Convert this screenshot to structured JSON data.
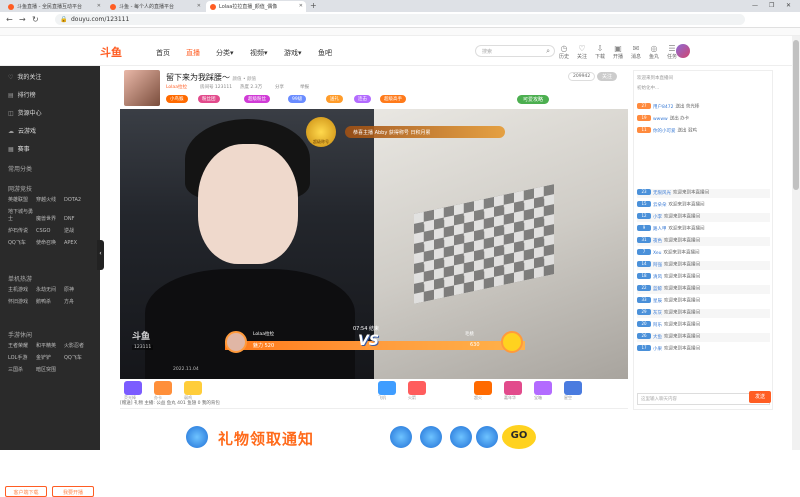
{
  "browser": {
    "tabs": [
      {
        "label": "斗鱼直播 - 全民直播互动平台",
        "icon_color": "#ff5d23"
      },
      {
        "label": "斗鱼 - 每个人的直播平台",
        "icon_color": "#ff5d23"
      },
      {
        "label": "Lolaa拉拉直播_颜值_偶像",
        "icon_color": "#ff5d23"
      }
    ],
    "new_tab": "+",
    "url": "douyu.com/123111",
    "window_controls": [
      "—",
      "❐",
      "✕"
    ]
  },
  "header": {
    "logo": "斗鱼",
    "nav": [
      {
        "label": "首页",
        "active": false
      },
      {
        "label": "直播",
        "active": true
      },
      {
        "label": "分类▾",
        "active": false
      },
      {
        "label": "视频▾",
        "active": false
      },
      {
        "label": "游戏▾",
        "active": false
      },
      {
        "label": "鱼吧",
        "active": false
      }
    ],
    "search_placeholder": "搜索",
    "icons": [
      {
        "icon": "history-icon",
        "glyph": "◷",
        "label": "历史"
      },
      {
        "label": "关注",
        "icon": "follow-icon",
        "glyph": "♡"
      },
      {
        "label": "下载",
        "icon": "download-icon",
        "glyph": "⇩"
      },
      {
        "label": "开播",
        "icon": "live-icon",
        "glyph": "▣"
      },
      {
        "label": "消息",
        "icon": "message-icon",
        "glyph": "✉"
      },
      {
        "label": "鱼丸",
        "icon": "fishball-icon",
        "glyph": "◎"
      },
      {
        "label": "任务",
        "icon": "task-icon",
        "glyph": "☰"
      }
    ]
  },
  "sidebar": {
    "items": [
      {
        "icon": "heart-icon",
        "glyph": "♡",
        "label": "我的关注"
      },
      {
        "icon": "rank-icon",
        "glyph": "▤",
        "label": "排行榜"
      },
      {
        "icon": "shop-icon",
        "glyph": "◫",
        "label": "货源中心"
      },
      {
        "icon": "cloud-icon",
        "glyph": "☁",
        "label": "云游戏"
      },
      {
        "icon": "more-icon",
        "glyph": "▦",
        "label": "赛事"
      }
    ],
    "sections": [
      {
        "title": "常用分类",
        "items": []
      },
      {
        "title": "网游竞技",
        "items": [
          "英雄联盟",
          "穿越火线",
          "DOTA2",
          "地下城与勇士",
          "魔兽世界",
          "DNF",
          "炉石传说",
          "CSGO",
          "逆战",
          "QQ飞车",
          "使命召唤",
          "APEX"
        ]
      },
      {
        "title": "单机热游",
        "items": [
          "主机游戏",
          "永劫无间",
          "原神",
          "怀旧游戏",
          "鹅鸭杀",
          "方舟"
        ]
      },
      {
        "title": "手游休闲",
        "items": [
          "王者荣耀",
          "和平精英",
          "火影忍者",
          "LOL手游",
          "金铲铲",
          "QQ飞车",
          "三国杀",
          "暗区突围"
        ]
      }
    ],
    "bottom_buttons": [
      "客户端下载",
      "我要开播"
    ]
  },
  "room": {
    "title": "留下来为我踩腰～",
    "breadcrumb": "颜值 • 颜值",
    "anchor": "Lolaa拉拉",
    "room_no": "房间号 123111",
    "hot": "热度 2.3万",
    "meta_extra": "分享",
    "report": "举报",
    "tags": [
      {
        "label": "小鸟猴",
        "color": "#ff6a00"
      },
      {
        "label": "粉丝团",
        "color": "#e24b8c"
      },
      {
        "label": "超级粉丝",
        "color": "#d03bd6"
      },
      {
        "label": "99级",
        "color": "#6a8cff"
      },
      {
        "label": "送礼",
        "color": "#ff9c2a"
      },
      {
        "label": "连击",
        "color": "#b36bff"
      },
      {
        "label": "超级高手",
        "color": "#ff7a1a"
      }
    ],
    "follow_count": "209942",
    "follow_btn": "关注",
    "pk_status": "可爱攻略"
  },
  "video": {
    "banner_text": "恭喜主播 Abby 获得称号 日积月累",
    "badge_text": "超级称号",
    "pk_timer": "07:54 结束",
    "left_name": "Lolaa拉拉",
    "left_score": "魅力 520",
    "right_name": "毛桃",
    "right_score": "630",
    "vs": "VS",
    "logo": "斗鱼",
    "room_tag": "123111",
    "time_text": "2022.11.04"
  },
  "gifts": {
    "items": [
      {
        "label": "荧光棒",
        "color": "#7b5cff"
      },
      {
        "label": "办卡",
        "color": "#ff8f3a"
      },
      {
        "label": "弱鸡",
        "color": "#ffcd3a"
      },
      {
        "label": "飞机",
        "color": "#3f9dff"
      },
      {
        "label": "火箭",
        "color": "#ff5d5d"
      },
      {
        "label": "超火",
        "color": "#ff6a00"
      },
      {
        "label": "嘉年华",
        "color": "#e24b8c"
      },
      {
        "label": "宝箱",
        "color": "#b36bff"
      },
      {
        "label": "星空",
        "color": "#4a7bdf"
      }
    ],
    "bottom_meta": "[赠送] 礼物  主播: 公益  鱼丸 401  鱼翅 0  我的背包"
  },
  "promo": {
    "title": "礼物领取通知",
    "go": "GO"
  },
  "chat": {
    "rows": [
      {
        "lvl": "",
        "name": "",
        "text": "欢迎来到本直播间",
        "lvlcolor": "#ffb74d"
      },
      {
        "lvl": "",
        "name": "",
        "text": "初始化中...",
        "lvlcolor": "#ffb74d"
      },
      {
        "lvl": "27",
        "name": "用户8472",
        "text": "送出 荧光棒",
        "lvlcolor": "#ff8a3d"
      },
      {
        "lvl": "19",
        "name": "wwww",
        "text": "送出 办卡",
        "lvlcolor": "#ff8a3d"
      },
      {
        "lvl": "11",
        "name": "你的小可爱",
        "text": "送出 弱鸡",
        "lvlcolor": "#ff8a3d"
      },
      {
        "lvl": "23",
        "name": "无限风光",
        "text": "欢迎来到本直播间",
        "lvlcolor": "#4a90d9"
      },
      {
        "lvl": "15",
        "name": "云朵朵",
        "text": "欢迎来到本直播间",
        "lvlcolor": "#4a90d9"
      },
      {
        "lvl": "12",
        "name": "小李",
        "text": "欢迎来到本直播间",
        "lvlcolor": "#4a90d9"
      },
      {
        "lvl": "9",
        "name": "路人甲",
        "text": "欢迎来到本直播间",
        "lvlcolor": "#4a90d9"
      },
      {
        "lvl": "31",
        "name": "夜色",
        "text": "欢迎来到本直播间",
        "lvlcolor": "#4a90d9"
      },
      {
        "lvl": "7",
        "name": "Xeu",
        "text": "欢迎来到本直播间",
        "lvlcolor": "#4a90d9"
      },
      {
        "lvl": "14",
        "name": "阿强",
        "text": "欢迎来到本直播间",
        "lvlcolor": "#4a90d9"
      },
      {
        "lvl": "18",
        "name": "清风",
        "text": "欢迎来到本直播间",
        "lvlcolor": "#4a90d9"
      },
      {
        "lvl": "22",
        "name": "蓝鲸",
        "text": "欢迎来到本直播间",
        "lvlcolor": "#4a90d9"
      },
      {
        "lvl": "33",
        "name": "星辰",
        "text": "欢迎来到本直播间",
        "lvlcolor": "#4a90d9"
      },
      {
        "lvl": "29",
        "name": "灰灰",
        "text": "欢迎来到本直播间",
        "lvlcolor": "#4a90d9"
      },
      {
        "lvl": "20",
        "name": "阿乐",
        "text": "欢迎来到本直播间",
        "lvlcolor": "#4a90d9"
      },
      {
        "lvl": "26",
        "name": "大鱼",
        "text": "欢迎来到本直播间",
        "lvlcolor": "#4a90d9"
      },
      {
        "lvl": "17",
        "name": "小果",
        "text": "欢迎来到本直播间",
        "lvlcolor": "#4a90d9"
      }
    ],
    "input_placeholder": "这里输入聊天内容",
    "send": "发送"
  }
}
